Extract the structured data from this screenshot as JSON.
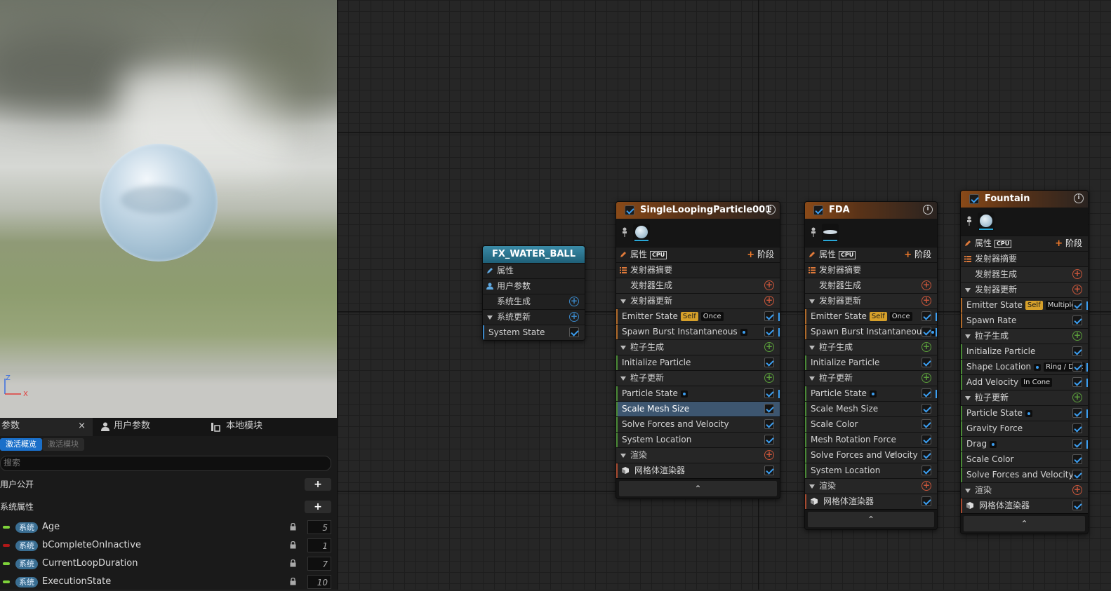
{
  "viewport": {
    "axis_z": "Z",
    "axis_x": "X"
  },
  "params_panel": {
    "tabs": [
      {
        "label": "参数",
        "close": "×"
      },
      {
        "label": "用户参数"
      },
      {
        "label": "本地模块"
      }
    ],
    "chips": [
      "激活概览",
      "激活模块"
    ],
    "search_placeholder": "搜索",
    "sections": [
      "用户公开",
      "系统属性"
    ],
    "add_label": "+",
    "badge": "系统",
    "rows": [
      {
        "name": "Age",
        "value": "5",
        "color": "#7ed23a"
      },
      {
        "name": "bCompleteOnInactive",
        "value": "1",
        "color": "#b01818"
      },
      {
        "name": "CurrentLoopDuration",
        "value": "7",
        "color": "#7ed23a"
      },
      {
        "name": "ExecutionState",
        "value": "10",
        "color": "#7ed23a"
      }
    ]
  },
  "system_node": {
    "title": "FX_WATER_BALL",
    "rows": [
      "属性",
      "用户参数",
      "系统生成",
      "系统更新",
      "System State"
    ]
  },
  "emitter_common": {
    "props": "属性",
    "cpu": "CPU",
    "stage_plus": "+",
    "stage": "阶段",
    "summary": "发射器摘要",
    "spawn": "发射器生成",
    "update": "发射器更新",
    "particle_spawn": "粒子生成",
    "particle_update": "粒子更新",
    "render": "渲染",
    "mesh_renderer": "网格体渲染器",
    "collapse": "⌃",
    "info": "i"
  },
  "emitters": [
    {
      "title": "SingleLoopingParticle001",
      "emitter_update": [
        {
          "label": "Emitter State",
          "tags": [
            "Self",
            "Once"
          ]
        },
        {
          "label": "Spawn Burst Instantaneous",
          "dot": true
        }
      ],
      "particle_spawn": [
        {
          "label": "Initialize Particle"
        }
      ],
      "particle_update": [
        {
          "label": "Particle State",
          "dot": true
        },
        {
          "label": "Scale Mesh Size",
          "selected": true
        },
        {
          "label": "Solve Forces and Velocity"
        },
        {
          "label": "System Location"
        }
      ]
    },
    {
      "title": "FDA",
      "emitter_update": [
        {
          "label": "Emitter State",
          "tags": [
            "Self",
            "Once"
          ]
        },
        {
          "label": "Spawn Burst Instantaneous",
          "dot": true
        }
      ],
      "particle_spawn": [
        {
          "label": "Initialize Particle"
        }
      ],
      "particle_update": [
        {
          "label": "Particle State",
          "dot": true
        },
        {
          "label": "Scale Mesh Size"
        },
        {
          "label": "Scale Color"
        },
        {
          "label": "Mesh Rotation Force"
        },
        {
          "label": "Solve Forces and Velocity",
          "reset": true
        },
        {
          "label": "System Location"
        }
      ]
    },
    {
      "title": "Fountain",
      "emitter_update": [
        {
          "label": "Emitter State",
          "tags": [
            "Self",
            "Multiple"
          ]
        },
        {
          "label": "Spawn Rate"
        }
      ],
      "particle_spawn": [
        {
          "label": "Initialize Particle"
        },
        {
          "label": "Shape Location",
          "dot": true,
          "tags": [
            "Ring / Disc"
          ]
        },
        {
          "label": "Add Velocity",
          "tags": [
            "In Cone"
          ]
        }
      ],
      "particle_update": [
        {
          "label": "Particle State",
          "dot": true
        },
        {
          "label": "Gravity Force"
        },
        {
          "label": "Drag",
          "dot": true
        },
        {
          "label": "Scale Color"
        },
        {
          "label": "Solve Forces and Velocity"
        }
      ]
    }
  ]
}
